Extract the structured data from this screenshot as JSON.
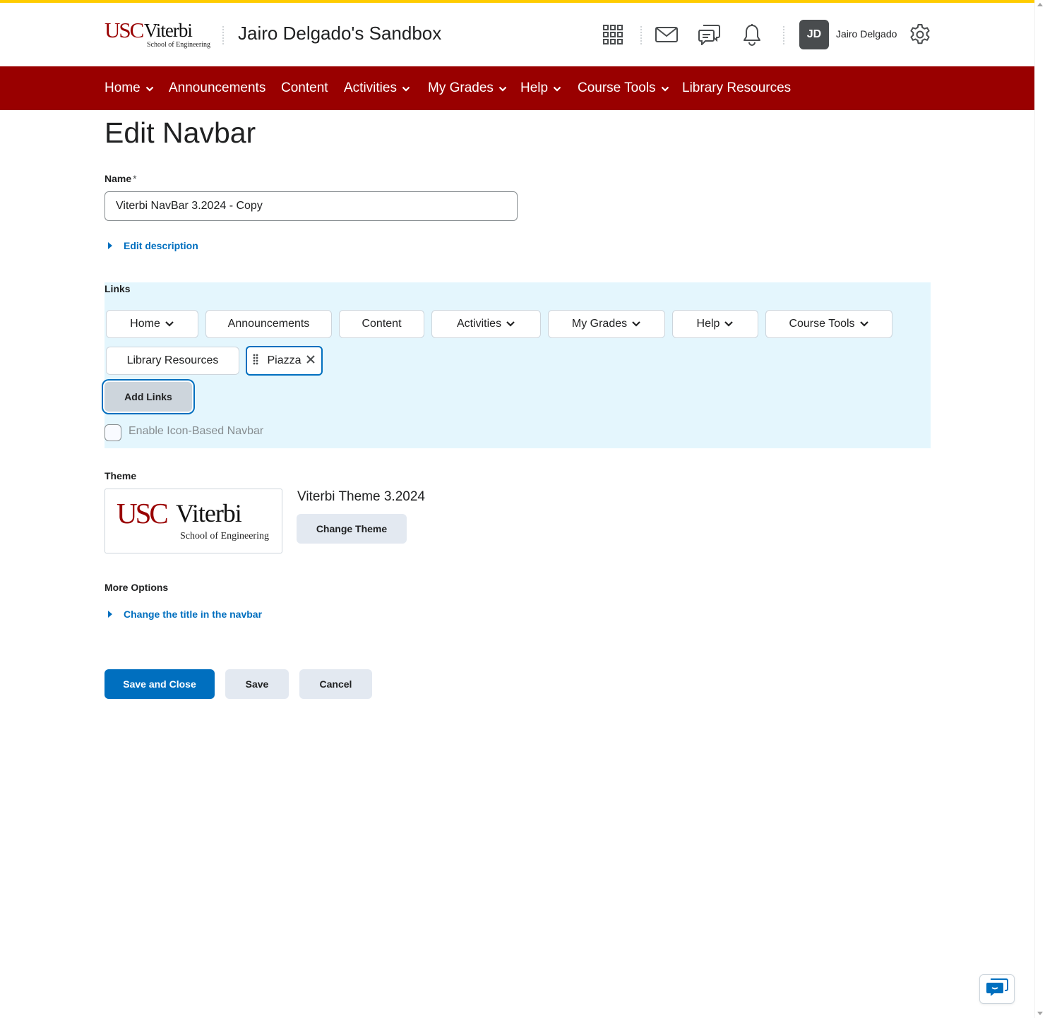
{
  "header": {
    "logo": {
      "usc": "USC",
      "viterbi": "Viterbi",
      "school": "School of Engineering"
    },
    "site_title": "Jairo Delgado's Sandbox",
    "user": {
      "initials": "JD",
      "name": "Jairo Delgado"
    },
    "icons": [
      "apps-grid-icon",
      "mail-icon",
      "chat-icon",
      "bell-icon",
      "gear-icon"
    ]
  },
  "navbar": {
    "items": [
      {
        "label": "Home",
        "has_menu": true
      },
      {
        "label": "Announcements",
        "has_menu": false
      },
      {
        "label": "Content",
        "has_menu": false
      },
      {
        "label": "Activities",
        "has_menu": true
      },
      {
        "label": "My Grades",
        "has_menu": true
      },
      {
        "label": "Help",
        "has_menu": true
      },
      {
        "label": "Course Tools",
        "has_menu": true
      },
      {
        "label": "Library Resources",
        "has_menu": false
      }
    ]
  },
  "page": {
    "title": "Edit Navbar",
    "name_label": "Name",
    "required_marker": "*",
    "name_value": "Viterbi NavBar 3.2024 - Copy",
    "edit_description": "Edit description",
    "links_label": "Links",
    "links": [
      {
        "label": "Home",
        "has_menu": true
      },
      {
        "label": "Announcements",
        "has_menu": false
      },
      {
        "label": "Content",
        "has_menu": false
      },
      {
        "label": "Activities",
        "has_menu": true
      },
      {
        "label": "My Grades",
        "has_menu": true
      },
      {
        "label": "Help",
        "has_menu": true
      },
      {
        "label": "Course Tools",
        "has_menu": true
      },
      {
        "label": "Library Resources",
        "has_menu": false
      },
      {
        "label": "Piazza",
        "selected": true
      }
    ],
    "add_links": "Add Links",
    "icon_navbar_label": "Enable Icon-Based Navbar",
    "icon_navbar_checked": false,
    "theme_label": "Theme",
    "theme_name": "Viterbi Theme 3.2024",
    "change_theme": "Change Theme",
    "more_options_label": "More Options",
    "change_title": "Change the title in the navbar",
    "save_and_close": "Save and Close",
    "save": "Save",
    "cancel": "Cancel"
  },
  "colors": {
    "brand": "#990000",
    "accent_stripe": "#ffcc00",
    "link": "#006fbf",
    "links_panel_bg": "#e4f6fd"
  }
}
